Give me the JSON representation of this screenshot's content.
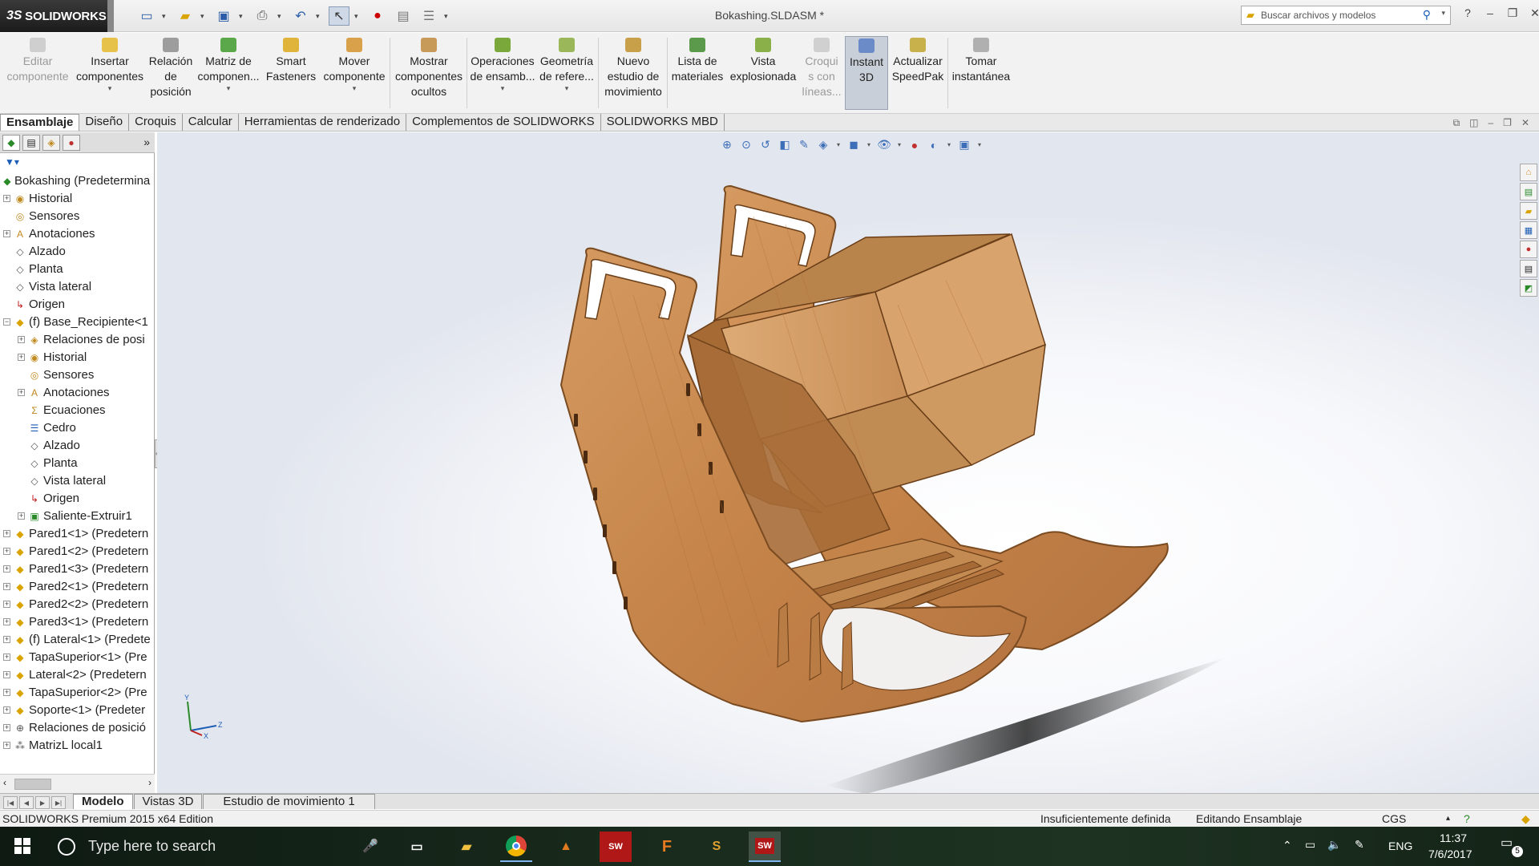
{
  "titlebar": {
    "app_name": "SOLIDWORKS",
    "document_title": "Bokashing.SLDASM *",
    "search_placeholder": "Buscar archivos y modelos"
  },
  "ribbon": {
    "buttons": [
      {
        "label": "Editar\ncomponente",
        "disabled": true
      },
      {
        "label": "Insertar\ncomponentes"
      },
      {
        "label": "Relación\nde\nposición"
      },
      {
        "label": "Matriz de\ncomponen..."
      },
      {
        "label": "Smart\nFasteners"
      },
      {
        "label": "Mover\ncomponente"
      },
      {
        "label": "Mostrar\ncomponentes\nocultos"
      },
      {
        "label": "Operaciones\nde ensamb..."
      },
      {
        "label": "Geometría\nde refere..."
      },
      {
        "label": "Nuevo\nestudio de\nmovimiento"
      },
      {
        "label": "Lista de\nmateriales"
      },
      {
        "label": "Vista\nexplosionada"
      },
      {
        "label": "Croqui\ns con\nlíneas...",
        "disabled": true
      },
      {
        "label": "Instant\n3D",
        "pressed": true
      },
      {
        "label": "Actualizar\nSpeedPak"
      },
      {
        "label": "Tomar\ninstantánea"
      }
    ]
  },
  "command_tabs": [
    "Ensamblaje",
    "Diseño",
    "Croquis",
    "Calcular",
    "Herramientas de renderizado",
    "Complementos de SOLIDWORKS",
    "SOLIDWORKS MBD"
  ],
  "feature_tree": {
    "nodes": [
      {
        "label": "Bokashing  (Predetermina",
        "icon": "assembly-icon",
        "level": 0,
        "expander": false
      },
      {
        "label": "Historial",
        "icon": "history-icon",
        "level": 1,
        "expander": true
      },
      {
        "label": "Sensores",
        "icon": "sensor-icon",
        "level": 1,
        "expander": false
      },
      {
        "label": "Anotaciones",
        "icon": "annotation-icon",
        "level": 1,
        "expander": true
      },
      {
        "label": "Alzado",
        "icon": "plane-icon",
        "level": 1,
        "expander": false
      },
      {
        "label": "Planta",
        "icon": "plane-icon",
        "level": 1,
        "expander": false
      },
      {
        "label": "Vista lateral",
        "icon": "plane-icon",
        "level": 1,
        "expander": false
      },
      {
        "label": "Origen",
        "icon": "origin-icon",
        "level": 1,
        "expander": false
      },
      {
        "label": "(f) Base_Recipiente<1",
        "icon": "part-icon",
        "level": 1,
        "expander": true,
        "expanded": true
      },
      {
        "label": "Relaciones de posi",
        "icon": "mate-icon",
        "level": 2,
        "expander": true
      },
      {
        "label": "Historial",
        "icon": "history-icon",
        "level": 2,
        "expander": true
      },
      {
        "label": "Sensores",
        "icon": "sensor-icon",
        "level": 2,
        "expander": false
      },
      {
        "label": "Anotaciones",
        "icon": "annotation-icon",
        "level": 2,
        "expander": true
      },
      {
        "label": "Ecuaciones",
        "icon": "equation-icon",
        "level": 2,
        "expander": false
      },
      {
        "label": "Cedro",
        "icon": "material-icon",
        "level": 2,
        "expander": false
      },
      {
        "label": "Alzado",
        "icon": "plane-icon",
        "level": 2,
        "expander": false
      },
      {
        "label": "Planta",
        "icon": "plane-icon",
        "level": 2,
        "expander": false
      },
      {
        "label": "Vista lateral",
        "icon": "plane-icon",
        "level": 2,
        "expander": false
      },
      {
        "label": "Origen",
        "icon": "origin-icon",
        "level": 2,
        "expander": false
      },
      {
        "label": "Saliente-Extruir1",
        "icon": "extrude-icon",
        "level": 2,
        "expander": true
      },
      {
        "label": "Pared1<1> (Predetern",
        "icon": "part-icon",
        "level": 1,
        "expander": true
      },
      {
        "label": "Pared1<2> (Predetern",
        "icon": "part-icon",
        "level": 1,
        "expander": true
      },
      {
        "label": "Pared1<3> (Predetern",
        "icon": "part-icon",
        "level": 1,
        "expander": true
      },
      {
        "label": "Pared2<1> (Predetern",
        "icon": "part-icon",
        "level": 1,
        "expander": true
      },
      {
        "label": "Pared2<2> (Predetern",
        "icon": "part-icon",
        "level": 1,
        "expander": true
      },
      {
        "label": "Pared3<1> (Predetern",
        "icon": "part-icon",
        "level": 1,
        "expander": true
      },
      {
        "label": "(f) Lateral<1> (Predete",
        "icon": "part-icon",
        "level": 1,
        "expander": true
      },
      {
        "label": "TapaSuperior<1> (Pre",
        "icon": "part-icon",
        "level": 1,
        "expander": true
      },
      {
        "label": "Lateral<2> (Predetern",
        "icon": "part-icon",
        "level": 1,
        "expander": true
      },
      {
        "label": "TapaSuperior<2> (Pre",
        "icon": "part-icon",
        "level": 1,
        "expander": true
      },
      {
        "label": "Soporte<1> (Predeter",
        "icon": "part-icon",
        "level": 1,
        "expander": true
      },
      {
        "label": "Relaciones de posició",
        "icon": "mates-folder-icon",
        "level": 1,
        "expander": true
      },
      {
        "label": "MatrizL local1",
        "icon": "pattern-icon",
        "level": 1,
        "expander": true
      }
    ]
  },
  "bottom_tabs": [
    "Modelo",
    "Vistas 3D",
    "Estudio de movimiento 1"
  ],
  "statusbar": {
    "edition": "SOLIDWORKS Premium 2015 x64 Edition",
    "definition": "Insuficientemente definida",
    "mode": "Editando Ensamblaje",
    "units": "CGS"
  },
  "taskbar": {
    "search_placeholder": "Type here to search",
    "language": "ENG",
    "time": "11:37",
    "date": "7/6/2017",
    "notifications": "5"
  },
  "triad": {
    "x": "X",
    "y": "Y",
    "z": "Z"
  },
  "colors": {
    "wood": "#c8894f",
    "wood_dark": "#8a5526",
    "accent": "#1c5db5"
  }
}
